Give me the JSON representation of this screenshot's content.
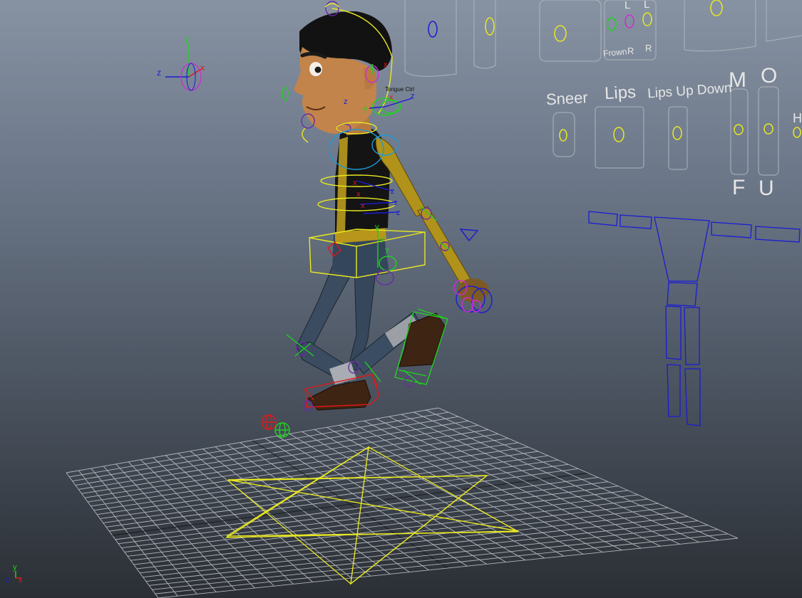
{
  "viewport": {
    "label": "3D perspective viewport"
  },
  "colors": {
    "bg_top": "#8793a3",
    "bg_bottom": "#2b2f35",
    "grid": "#c9ccd1",
    "control_yellow": "#e8e820",
    "control_blue": "#1b1bd6",
    "control_green": "#1fd21f",
    "control_red": "#e01818",
    "control_magenta": "#d02cd0",
    "shirt": "#141414",
    "skin": "#c2844a",
    "pants": "#36475b",
    "arm": "#b1921a",
    "hair": "#121212"
  },
  "axis": {
    "x": "x",
    "y": "y",
    "z": "z"
  },
  "face_panel": {
    "labels": {
      "sneer": "Sneer",
      "lips": "Lips",
      "lips_up_down": "Lips Up Down",
      "m": "M",
      "o": "O",
      "f": "F",
      "u": "U",
      "l1": "L",
      "l2": "L",
      "frown": "Frown",
      "r1": "R",
      "r2": "R",
      "h": "H"
    }
  },
  "rig": {
    "tongue_ctrl": "Tongue Ctrl"
  }
}
